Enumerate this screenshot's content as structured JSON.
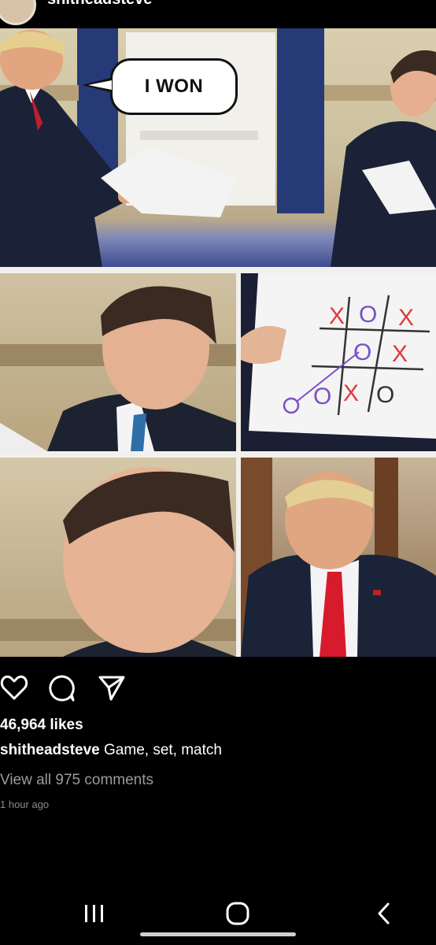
{
  "header": {
    "username": "shitheadsteve"
  },
  "post": {
    "speech_bubble": "I WON",
    "board": {
      "row1": [
        "X",
        "O",
        "X"
      ],
      "row2": [
        "",
        "O",
        "X"
      ],
      "row3": [
        "O",
        "X",
        "O"
      ]
    }
  },
  "actions": {
    "like_icon": "heart-icon",
    "comment_icon": "comment-icon",
    "share_icon": "send-icon"
  },
  "likes": "46,964 likes",
  "caption": {
    "username": "shitheadsteve",
    "text": "Game, set, match"
  },
  "comments_link": "View all 975 comments",
  "timestamp": "1 hour ago",
  "colors": {
    "background": "#000000",
    "tie": "#d81b2c",
    "pen": "#7a4fc9",
    "pen_red": "#e03a3a"
  }
}
